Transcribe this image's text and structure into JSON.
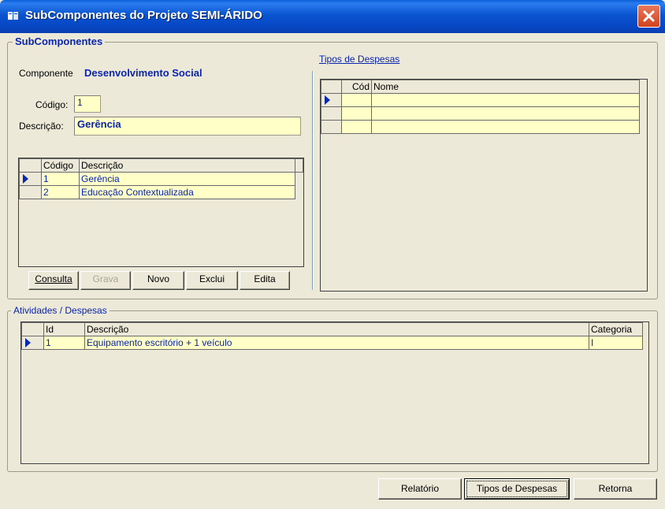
{
  "window": {
    "title": "SubComponentes do Projeto SEMI-ÁRIDO"
  },
  "subcomponentes": {
    "group_title": "SubComponentes",
    "componente_label": "Componente",
    "componente_value": "Desenvolvimento Social",
    "codigo_label": "Código:",
    "codigo_value": "1",
    "descricao_label": "Descrição:",
    "descricao_value": "Gerência",
    "grid": {
      "headers": [
        "Código",
        "Descrição"
      ],
      "rows": [
        {
          "codigo": "1",
          "descricao": "Gerência",
          "current": true
        },
        {
          "codigo": "2",
          "descricao": "Educação Contextualizada",
          "current": false
        }
      ]
    },
    "buttons": {
      "consulta": {
        "label": "Consulta",
        "enabled": true
      },
      "grava": {
        "label": "Grava",
        "enabled": false
      },
      "novo": {
        "label": "Novo",
        "enabled": true
      },
      "exclui": {
        "label": "Exclui",
        "enabled": true
      },
      "edita": {
        "label": "Edita",
        "enabled": true
      }
    }
  },
  "tipos_despesas": {
    "link_label": "Tipos de Despesas",
    "grid": {
      "headers": [
        "Cód",
        "Nome"
      ],
      "rows": [
        {
          "cod": "",
          "nome": "",
          "current": true
        },
        {
          "cod": "",
          "nome": "",
          "current": false
        },
        {
          "cod": "",
          "nome": "",
          "current": false
        }
      ]
    }
  },
  "atividades": {
    "group_title": "Atividades / Despesas",
    "grid": {
      "headers": [
        "Id",
        "Descrição",
        "Categoria"
      ],
      "rows": [
        {
          "id": "1",
          "descricao": "Equipamento escritório + 1 veículo",
          "categoria": "I",
          "current": true
        }
      ]
    }
  },
  "footer_buttons": {
    "relatorio": "Relatório",
    "tipos_despesas": "Tipos de Despesas",
    "retorna": "Retorna"
  },
  "colors": {
    "field_bg": "#ffffc8",
    "data_text": "#0a24b0",
    "title_bar": "#0a54d0",
    "link": "#0a24b0"
  }
}
